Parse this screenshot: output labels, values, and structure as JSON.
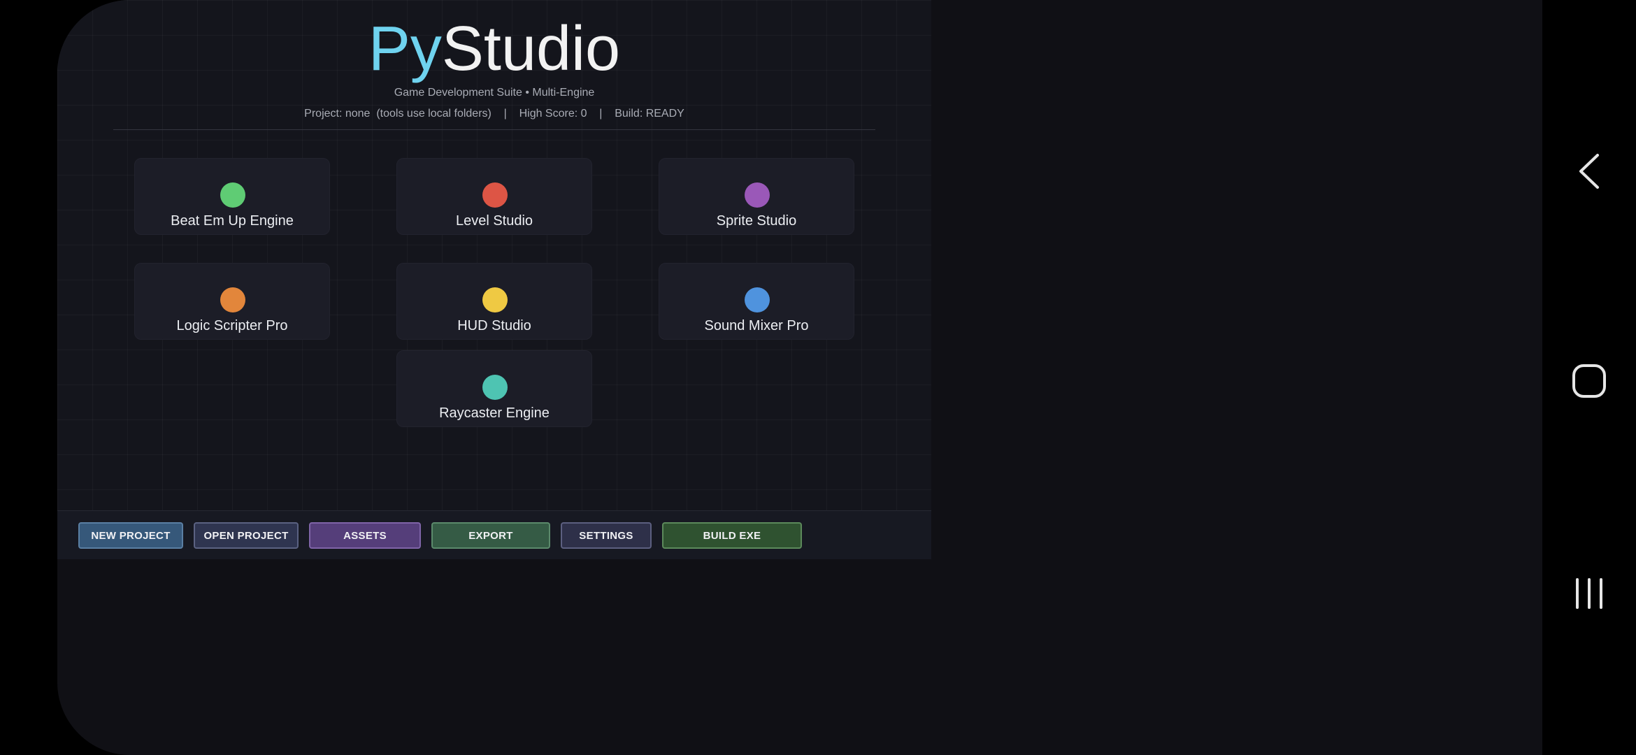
{
  "app": {
    "title_accent": "Py",
    "title_main": "Studio",
    "subtitle": "Game Development Suite  •  Multi-Engine",
    "status": "Project: none  (tools use local folders)    |    High Score: 0    |    Build: READY"
  },
  "tools": [
    {
      "label": "Beat Em Up Engine",
      "color": "#5fcc74"
    },
    {
      "label": "Level Studio",
      "color": "#dd5545"
    },
    {
      "label": "Sprite Studio",
      "color": "#9a58b8"
    },
    {
      "label": "Logic Scripter Pro",
      "color": "#e2863b"
    },
    {
      "label": "HUD Studio",
      "color": "#efc943"
    },
    {
      "label": "Sound Mixer Pro",
      "color": "#4f93de"
    },
    {
      "label": "Raycaster Engine",
      "color": "#4ec4b2"
    }
  ],
  "toolbar": {
    "new_project": "NEW PROJECT",
    "open_project": "OPEN PROJECT",
    "assets": "ASSETS",
    "export": "EXPORT",
    "settings": "SETTINGS",
    "build_exe": "BUILD EXE"
  },
  "colors": {
    "accent": "#6fd3ef",
    "background": "#14151c",
    "tile": "#1c1d27"
  },
  "navbar": {
    "icons": [
      "back-icon",
      "home-icon",
      "recents-icon"
    ]
  }
}
